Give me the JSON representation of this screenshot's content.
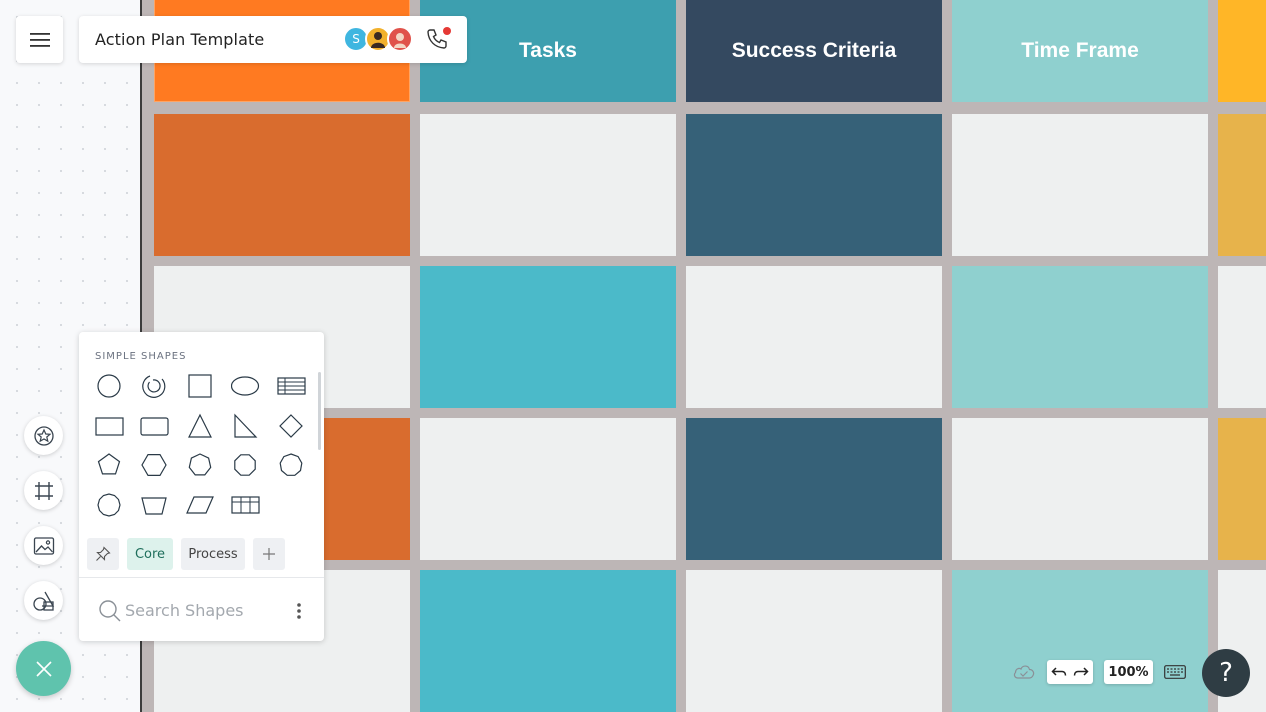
{
  "document": {
    "title": "Action Plan Template"
  },
  "collaborators": [
    {
      "initial": "S",
      "color": "#3fb6e0"
    },
    {
      "initial": "",
      "color": "#f2b12c"
    },
    {
      "initial": "",
      "color": "#e0524a"
    }
  ],
  "board": {
    "headers": [
      "",
      "Tasks",
      "Success Criteria",
      "Time Frame",
      ""
    ],
    "colors": {
      "orange_header": "#ff7a21",
      "orange": "#d96c2e",
      "teal_header": "#3d9faf",
      "teal": "#4bbac9",
      "navy_header": "#344960",
      "navy": "#366178",
      "mint": "#8fd0cf",
      "light": "#eef0f0",
      "yellow_header": "#ffb627",
      "yellow": "#e7b34b",
      "grid": "#bdb6b6"
    },
    "rows": [
      [
        "orange_header",
        "teal_header",
        "navy_header",
        "mint",
        "yellow_header"
      ],
      [
        "orange",
        "light",
        "navy",
        "light",
        "yellow"
      ],
      [
        "light",
        "teal",
        "light",
        "mint",
        "light"
      ],
      [
        "orange",
        "light",
        "navy",
        "light",
        "yellow"
      ],
      [
        "light",
        "teal",
        "light",
        "mint",
        "light"
      ]
    ]
  },
  "shapes_panel": {
    "heading": "SIMPLE SHAPES",
    "shapes": [
      "circle-icon",
      "arc-icon",
      "square-icon",
      "ellipse-icon",
      "table-icon",
      "rectangle-icon",
      "rounded-rectangle-icon",
      "triangle-icon",
      "right-triangle-icon",
      "diamond-icon",
      "pentagon-icon",
      "hexagon-icon",
      "heptagon-icon",
      "octagon-icon",
      "nonagon-icon",
      "decagon-icon",
      "trapezoid-icon",
      "parallelogram-icon",
      "grid-table-icon"
    ],
    "tags": [
      "Core",
      "Process"
    ],
    "search_placeholder": "Search Shapes"
  },
  "toolbar": {
    "zoom": "100%",
    "help": "?"
  }
}
